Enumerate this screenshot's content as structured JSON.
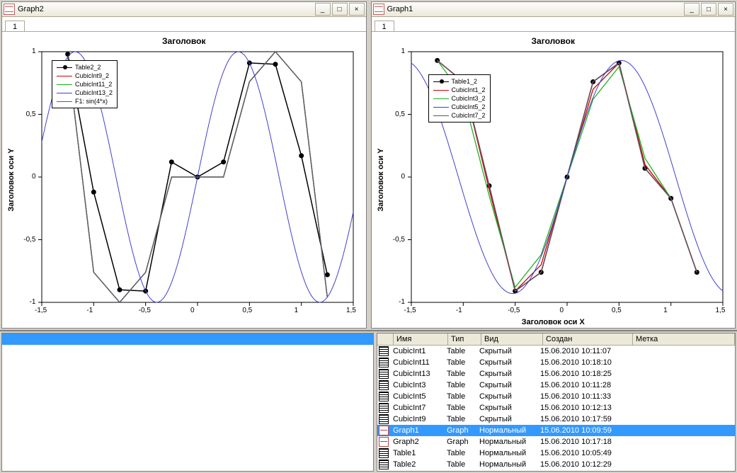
{
  "windows": {
    "left": {
      "title": "Graph2",
      "tab": "1"
    },
    "right": {
      "title": "Graph1",
      "tab": "1"
    }
  },
  "winbuttons": {
    "min": "_",
    "max": "□",
    "close": "×"
  },
  "chart_data": [
    {
      "id": "graph2",
      "type": "line",
      "title": "Заголовок",
      "xlabel": "",
      "ylabel": "Заголовок оси Y",
      "xlim": [
        -1.5,
        1.5
      ],
      "ylim": [
        -1.0,
        1.0
      ],
      "xticks": [
        -1.5,
        -1,
        -0.5,
        0,
        0.5,
        1,
        1.5
      ],
      "yticks": [
        -1,
        -0.5,
        0,
        0.5,
        1
      ],
      "series": [
        {
          "name": "Table2_2",
          "color": "#000000",
          "marker": true,
          "x": [
            -1.25,
            -1.0,
            -0.75,
            -0.5,
            -0.25,
            0.0,
            0.25,
            0.5,
            0.75,
            1.0,
            1.25
          ],
          "y": [
            0.98,
            -0.12,
            -0.9,
            -0.91,
            0.12,
            0.0,
            0.12,
            0.91,
            0.9,
            0.17,
            -0.78
          ]
        },
        {
          "name": "CubicInt9_2",
          "color": "#d00000",
          "x": [
            -1.25,
            -1.0,
            -0.75,
            -0.5,
            -0.25,
            0.0,
            0.25,
            0.5,
            0.75,
            1.0,
            1.25
          ],
          "y": [
            0.96,
            -0.76,
            -1.0,
            -0.76,
            0.0,
            0.0,
            0.0,
            0.76,
            1.0,
            0.76,
            -0.96
          ]
        },
        {
          "name": "CubicInt11_2",
          "color": "#20b020",
          "x": [
            -1.25,
            -1.0,
            -0.75,
            -0.5,
            -0.25,
            0.0,
            0.25,
            0.5,
            0.75,
            1.0,
            1.25
          ],
          "y": [
            0.96,
            -0.76,
            -1.0,
            -0.76,
            0.0,
            0.0,
            0.0,
            0.76,
            1.0,
            0.76,
            -0.96
          ]
        },
        {
          "name": "CubicInt13_2",
          "color": "#4040d0",
          "x": [
            -1.25,
            -1.0,
            -0.75,
            -0.5,
            -0.25,
            0.0,
            0.25,
            0.5,
            0.75,
            1.0,
            1.25
          ],
          "y": [
            0.96,
            -0.76,
            -1.0,
            -0.76,
            0.0,
            0.0,
            0.0,
            0.76,
            1.0,
            0.76,
            -0.96
          ]
        },
        {
          "name": "F1: sin(4*x)",
          "color": "#606060",
          "x": [
            -1.25,
            -1.0,
            -0.75,
            -0.5,
            -0.25,
            0.0,
            0.25,
            0.5,
            0.75,
            1.0,
            1.25
          ],
          "y": [
            0.96,
            -0.76,
            -1.0,
            -0.76,
            0.0,
            0.0,
            0.0,
            0.76,
            1.0,
            0.76,
            -0.96
          ]
        }
      ]
    },
    {
      "id": "graph1",
      "type": "line",
      "title": "Заголовок",
      "xlabel": "Заголовок оси Х",
      "ylabel": "Заголовок оси Y",
      "xlim": [
        -1.5,
        1.5
      ],
      "ylim": [
        -1.0,
        1.0
      ],
      "xticks": [
        -1.5,
        -1,
        -0.5,
        0,
        0.5,
        1,
        1.5
      ],
      "yticks": [
        -1,
        -0.5,
        0,
        0.5,
        1
      ],
      "series": [
        {
          "name": "Table1_2",
          "color": "#000000",
          "marker": true,
          "x": [
            -1.25,
            -1.0,
            -0.75,
            -0.5,
            -0.25,
            0.0,
            0.25,
            0.5,
            0.75,
            1.0,
            1.25
          ],
          "y": [
            0.93,
            0.76,
            -0.07,
            -0.91,
            -0.76,
            0.0,
            0.76,
            0.91,
            0.07,
            -0.17,
            -0.76
          ]
        },
        {
          "name": "CubicInt1_2",
          "color": "#d00000",
          "x": [
            -1.25,
            -1.0,
            -0.75,
            -0.5,
            -0.25,
            0.0,
            0.25,
            0.5,
            0.75,
            1.0,
            1.25
          ],
          "y": [
            0.93,
            0.76,
            -0.1,
            -0.91,
            -0.7,
            0.0,
            0.7,
            0.91,
            0.1,
            -0.17,
            -0.76
          ]
        },
        {
          "name": "CubicInt3_2",
          "color": "#20b020",
          "x": [
            -1.25,
            -1.0,
            -0.75,
            -0.5,
            -0.25,
            0.0,
            0.25,
            0.5,
            0.75,
            1.0,
            1.25
          ],
          "y": [
            0.93,
            0.65,
            -0.15,
            -0.88,
            -0.62,
            0.0,
            0.62,
            0.88,
            0.15,
            -0.17,
            -0.76
          ]
        },
        {
          "name": "CubicInt5_2",
          "color": "#4040d0",
          "x": [
            -1.25,
            -1.0,
            -0.75,
            -0.5,
            -0.25,
            0.0,
            0.25,
            0.5,
            0.75,
            1.0,
            1.25
          ],
          "y": [
            0.93,
            0.76,
            -0.07,
            -0.91,
            -0.76,
            0.0,
            0.76,
            0.91,
            0.07,
            -0.17,
            -0.76
          ]
        },
        {
          "name": "CubicInt7_2",
          "color": "#705050",
          "x": [
            -1.25,
            -1.0,
            -0.75,
            -0.5,
            -0.25,
            0.0,
            0.25,
            0.5,
            0.75,
            1.0,
            1.25
          ],
          "y": [
            0.93,
            0.76,
            -0.07,
            -0.91,
            -0.76,
            0.0,
            0.76,
            0.91,
            0.07,
            -0.17,
            -0.76
          ]
        }
      ]
    }
  ],
  "table": {
    "headers": {
      "name": "Имя",
      "type": "Тип",
      "kind": "Вид",
      "created": "Создан",
      "mark": "Метка"
    },
    "rows": [
      {
        "icon": "table",
        "name": "CubicInt1",
        "type": "Table",
        "kind": "Скрытый",
        "created": "15.06.2010 10:11:07",
        "mark": ""
      },
      {
        "icon": "table",
        "name": "CubicInt11",
        "type": "Table",
        "kind": "Скрытый",
        "created": "15.06.2010 10:18:10",
        "mark": ""
      },
      {
        "icon": "table",
        "name": "CubicInt13",
        "type": "Table",
        "kind": "Скрытый",
        "created": "15.06.2010 10:18:25",
        "mark": ""
      },
      {
        "icon": "table",
        "name": "CubicInt3",
        "type": "Table",
        "kind": "Скрытый",
        "created": "15.06.2010 10:11:28",
        "mark": ""
      },
      {
        "icon": "table",
        "name": "CubicInt5",
        "type": "Table",
        "kind": "Скрытый",
        "created": "15.06.2010 10:11:33",
        "mark": ""
      },
      {
        "icon": "table",
        "name": "CubicInt7",
        "type": "Table",
        "kind": "Скрытый",
        "created": "15.06.2010 10:12:13",
        "mark": ""
      },
      {
        "icon": "table",
        "name": "CubicInt9",
        "type": "Table",
        "kind": "Скрытый",
        "created": "15.06.2010 10:17:59",
        "mark": ""
      },
      {
        "icon": "graph",
        "name": "Graph1",
        "type": "Graph",
        "kind": "Нормальный",
        "created": "15.06.2010 10:09:59",
        "mark": "",
        "selected": true
      },
      {
        "icon": "graph",
        "name": "Graph2",
        "type": "Graph",
        "kind": "Нормальный",
        "created": "15.06.2010 10:17:18",
        "mark": ""
      },
      {
        "icon": "table",
        "name": "Table1",
        "type": "Table",
        "kind": "Нормальный",
        "created": "15.06.2010 10:05:49",
        "mark": ""
      },
      {
        "icon": "table",
        "name": "Table2",
        "type": "Table",
        "kind": "Нормальный",
        "created": "15.06.2010 10:12:29",
        "mark": ""
      }
    ]
  }
}
